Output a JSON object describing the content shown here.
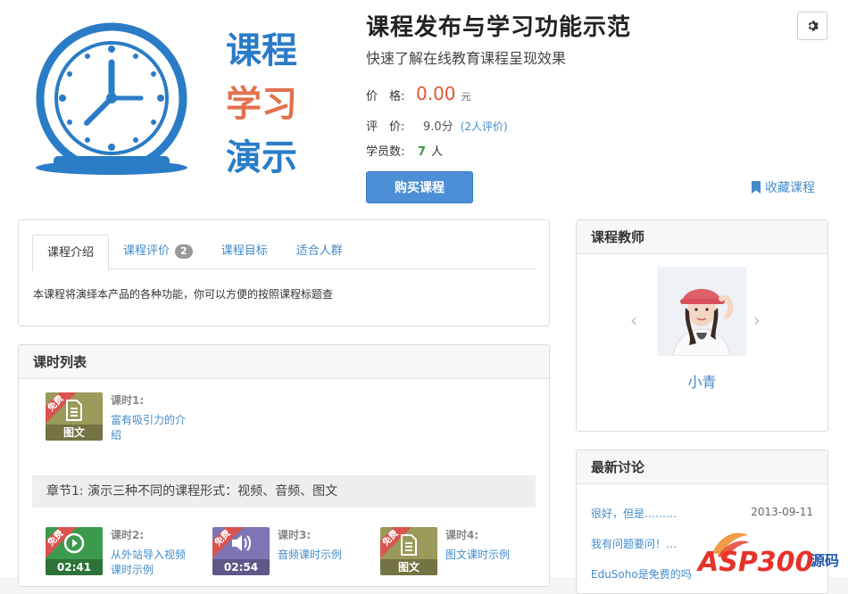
{
  "course": {
    "image_text": [
      "课程",
      "学习",
      "演示"
    ],
    "title": "课程发布与学习功能示范",
    "subtitle": "快速了解在线教育课程呈现效果",
    "price_label": "价　格:",
    "price_value": "0.00",
    "price_unit": "元",
    "rating_label": "评　价:",
    "rating_value": "9.0分",
    "rating_count": "(2人评价)",
    "students_label": "学员数:",
    "students_value": "7",
    "students_unit": "人",
    "buy_label": "购买课程",
    "favorite_label": "收藏课程"
  },
  "tabs": {
    "items": [
      {
        "label": "课程介绍"
      },
      {
        "label": "课程评价",
        "badge": "2"
      },
      {
        "label": "课程目标"
      },
      {
        "label": "适合人群"
      }
    ],
    "content": "本课程将演绎本产品的各种功能，你可以方便的按照课程标题查"
  },
  "lessons": {
    "heading": "课时列表",
    "free_badge": "免费",
    "items": [
      {
        "num": "课时1:",
        "name": "富有吸引力的介绍",
        "thumb_label": "图文",
        "icon": "document-icon",
        "color": "#9a9a5a"
      },
      {
        "num": "课时2:",
        "name": "从外站导入视频课时示例",
        "thumb_label": "02:41",
        "icon": "play-icon",
        "color": "#3c9a4c"
      },
      {
        "num": "课时3:",
        "name": "音频课时示例",
        "thumb_label": "02:54",
        "icon": "audio-icon",
        "color": "#7f74b4"
      },
      {
        "num": "课时4:",
        "name": "图文课时示例",
        "thumb_label": "图文",
        "icon": "document-icon",
        "color": "#9a9a5a"
      }
    ],
    "chapter": "章节1: 演示三种不同的课程形式：视频、音频、图文"
  },
  "teacher": {
    "heading": "课程教师",
    "name": "小青",
    "prev": "‹",
    "next": "›"
  },
  "discussions": {
    "heading": "最新讨论",
    "items": [
      {
        "title": "很好，但是………",
        "date": "2013-09-11"
      },
      {
        "title": "我有问题要问！…",
        "date": ""
      },
      {
        "title": "EduSoho是免费的吗",
        "date": ""
      }
    ]
  },
  "watermark": {
    "text": "ASP300",
    "suffix": "源码"
  },
  "colors": {
    "accent": "#428bca",
    "price": "#e4572e",
    "students": "#3c9a3c",
    "button": "#4d8fd6",
    "free": "#d9534f"
  }
}
